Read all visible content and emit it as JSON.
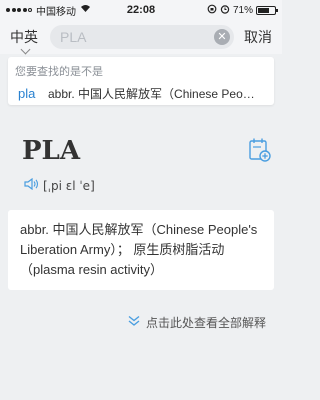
{
  "status": {
    "carrier": "中国移动",
    "time": "22:08",
    "battery_pct": "71%",
    "battery_level": 0.71
  },
  "search": {
    "lang_label": "中英",
    "query": "PLA",
    "cancel_label": "取消"
  },
  "suggestion": {
    "hint": "您要查找的是不是",
    "word": "pla",
    "definition": "abbr. 中国人民解放军（Chinese People's Liberation Army）"
  },
  "entry": {
    "headword": "PLA",
    "phonetic": "[ˌpi ɛl ˈe]",
    "definition": "abbr. 中国人民解放军（Chinese People's Liberation Army）； 原生质树脂活动（plasma resin activity）"
  },
  "expand_label": "点击此处查看全部解释",
  "colors": {
    "accent": "#2a82d0",
    "background": "#eef0f2",
    "icon_blue": "#4a9ee0"
  },
  "icons": {
    "wifi": "wifi-icon",
    "alarm": "alarm-icon",
    "speaker": "speaker-icon",
    "notebook_add": "notebook-add-icon",
    "expand": "double-chevron-down-icon"
  }
}
